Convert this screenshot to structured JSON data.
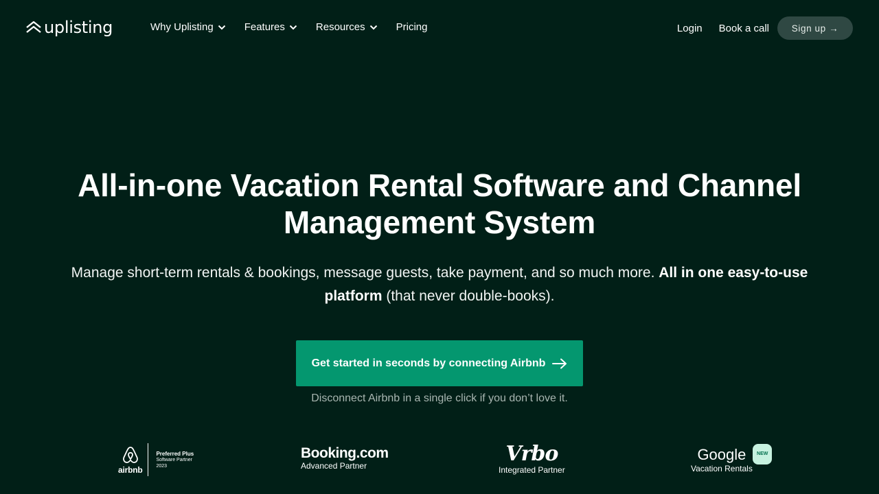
{
  "brand": {
    "name": "uplisting"
  },
  "nav": {
    "menu": [
      {
        "label": "Why Uplisting",
        "has_dropdown": true
      },
      {
        "label": "Features",
        "has_dropdown": true
      },
      {
        "label": "Resources",
        "has_dropdown": true
      },
      {
        "label": "Pricing",
        "has_dropdown": false
      }
    ],
    "login": "Login",
    "book_call": "Book a call",
    "signup": "Sign up →"
  },
  "hero": {
    "title": "All-in-one Vacation Rental Software and Channel Management System",
    "subtitle_plain": "Manage short-term rentals & bookings, message guests, take payment, and so much more. ",
    "subtitle_bold": "All in one easy-to-use platform",
    "subtitle_tail": " (that never double-books).",
    "cta_label": "Get started in seconds by connecting Airbnb",
    "cta_note": "Disconnect Airbnb in a single click if you don’t love it."
  },
  "partners": {
    "airbnb": {
      "name": "airbnb",
      "badge_line1": "Preferred Plus",
      "badge_line2": "Software Partner",
      "badge_line3": "2023"
    },
    "booking": {
      "name": "Booking.com",
      "subtitle": "Advanced Partner"
    },
    "vrbo": {
      "name": "Vrbo",
      "subtitle": "Integrated Partner"
    },
    "google": {
      "name": "Google",
      "badge": "NEW",
      "subtitle": "Vacation Rentals"
    }
  },
  "colors": {
    "background": "#011f17",
    "cta": "#04976f",
    "signup_bg": "#2f4843"
  }
}
